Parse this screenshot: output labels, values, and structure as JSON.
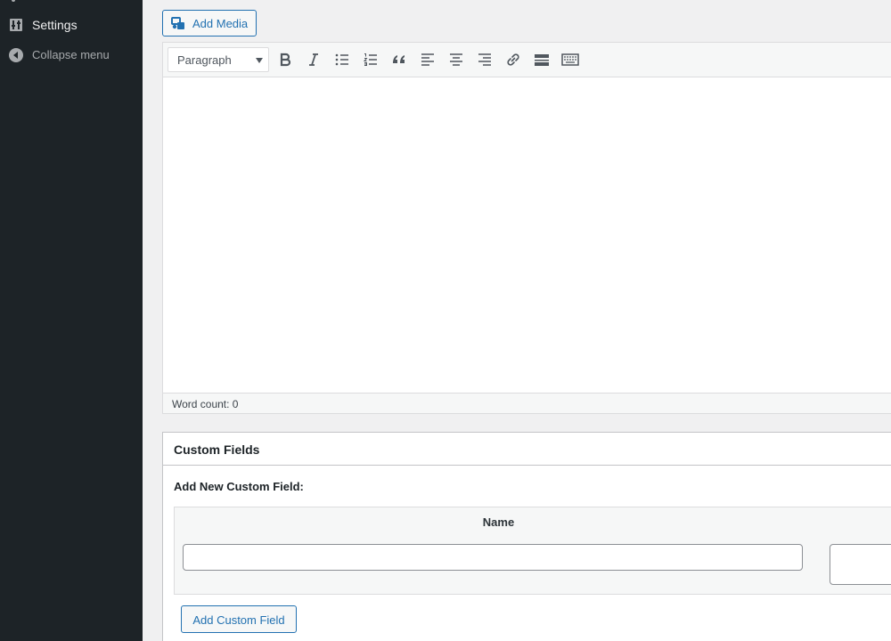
{
  "sidebar": {
    "items": [
      {
        "label": "Settings",
        "icon": "settings-icon"
      },
      {
        "label": "Collapse menu",
        "icon": "collapse-icon"
      }
    ]
  },
  "editor": {
    "add_media_label": "Add Media",
    "format_select": {
      "value": "Paragraph"
    },
    "toolbar_icons": [
      "bold-icon",
      "italic-icon",
      "bulleted-list-icon",
      "numbered-list-icon",
      "blockquote-icon",
      "align-left-icon",
      "align-center-icon",
      "align-right-icon",
      "link-icon",
      "read-more-icon",
      "toolbar-toggle-icon"
    ],
    "word_count": "Word count: 0"
  },
  "custom_fields": {
    "title": "Custom Fields",
    "subtitle": "Add New Custom Field:",
    "name_header": "Name",
    "name_value": "",
    "value_value": "",
    "add_button_label": "Add Custom Field"
  },
  "colors": {
    "sidebar_bg": "#1d2327",
    "accent": "#2271b1",
    "page_bg": "#f0f0f1"
  }
}
